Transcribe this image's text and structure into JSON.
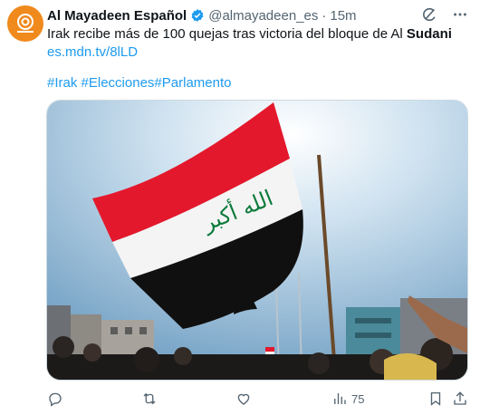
{
  "author": {
    "name": "Al Mayadeen Español",
    "handle": "@almayadeen_es",
    "time": "15m"
  },
  "tweet": {
    "text_main": "Irak recibe más de 100 quejas tras victoria del bloque de Al ",
    "text_bold": "Sudani",
    "link": "es.mdn.tv/8lLD",
    "hashtags": [
      "#Irak",
      "#Elecciones",
      "#Parlamento"
    ]
  },
  "media": {
    "flag_text": "الله أكبر",
    "flag_colors": {
      "red": "#e4182c",
      "white": "#f4f4f4",
      "black": "#101010",
      "green": "#0b7a3a"
    }
  },
  "actions": {
    "reply_count": "",
    "retweet_count": "",
    "like_count": "",
    "views_count": "75"
  },
  "colors": {
    "accent": "#1d9bf0",
    "muted": "#536471",
    "avatar": "#f08a1d"
  },
  "icons": [
    "grok-icon",
    "more-icon",
    "reply-icon",
    "retweet-icon",
    "like-icon",
    "views-icon",
    "bookmark-icon",
    "share-icon",
    "verified-icon"
  ]
}
